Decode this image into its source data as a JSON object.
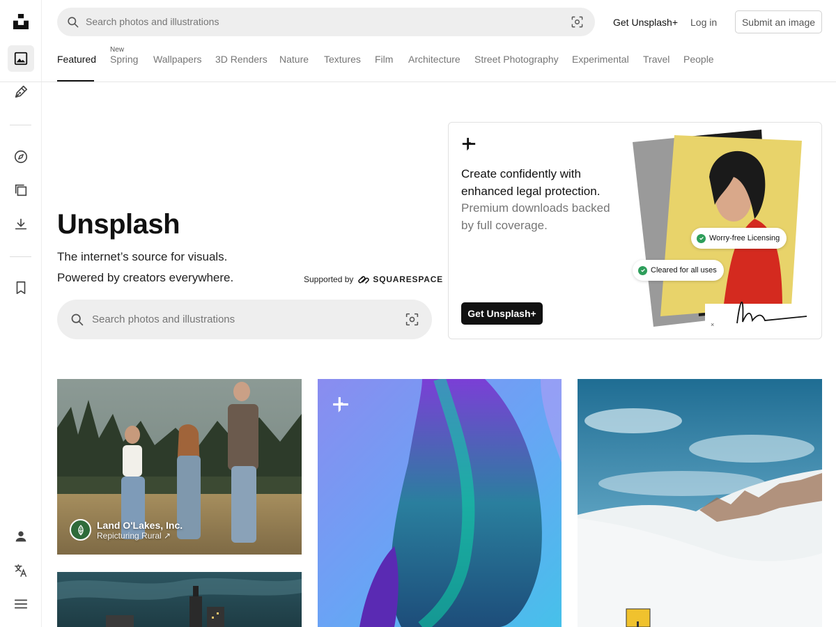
{
  "header": {
    "search_placeholder": "Search photos and illustrations",
    "get_plus": "Get Unsplash+",
    "login": "Log in",
    "submit": "Submit an image"
  },
  "sidebar": {
    "items": [
      {
        "icon": "unsplash-logo-icon"
      },
      {
        "icon": "image-icon",
        "active": true
      },
      {
        "icon": "pen-icon"
      },
      {
        "icon": "compass-icon"
      },
      {
        "icon": "collections-icon"
      },
      {
        "icon": "download-icon"
      },
      {
        "icon": "bookmark-icon"
      },
      {
        "icon": "user-icon"
      },
      {
        "icon": "translate-icon"
      },
      {
        "icon": "menu-icon"
      }
    ]
  },
  "topics": {
    "new_badge": "New",
    "tabs": [
      {
        "label": "Featured",
        "active": true
      },
      {
        "label": "Spring"
      },
      {
        "label": "Wallpapers"
      },
      {
        "label": "3D Renders"
      },
      {
        "label": "Nature"
      },
      {
        "label": "Textures"
      },
      {
        "label": "Film"
      },
      {
        "label": "Architecture"
      },
      {
        "label": "Street Photography"
      },
      {
        "label": "Experimental"
      },
      {
        "label": "Travel"
      },
      {
        "label": "People"
      }
    ]
  },
  "hero": {
    "title": "Unsplash",
    "subtitle_line1": "The internet’s source for visuals.",
    "subtitle_line2": "Powered by creators everywhere.",
    "supported_by": "Supported by",
    "sponsor": "SQUARESPACE",
    "search_placeholder": "Search photos and illustrations"
  },
  "promo": {
    "headline": "Create confidently with enhanced legal protection.",
    "subline": "Premium downloads backed by full coverage.",
    "button": "Get Unsplash+",
    "chip1": "Worry-free Licensing",
    "chip2": "Cleared for all uses"
  },
  "photos": {
    "first_credit_name": "Land O'Lakes, Inc.",
    "first_credit_sponsor": "Repicturing Rural ↗"
  },
  "colors": {
    "accent_dark": "#111111",
    "muted_text": "#767676",
    "search_bg": "#eeeeee",
    "check_green": "#2e9e5b"
  }
}
